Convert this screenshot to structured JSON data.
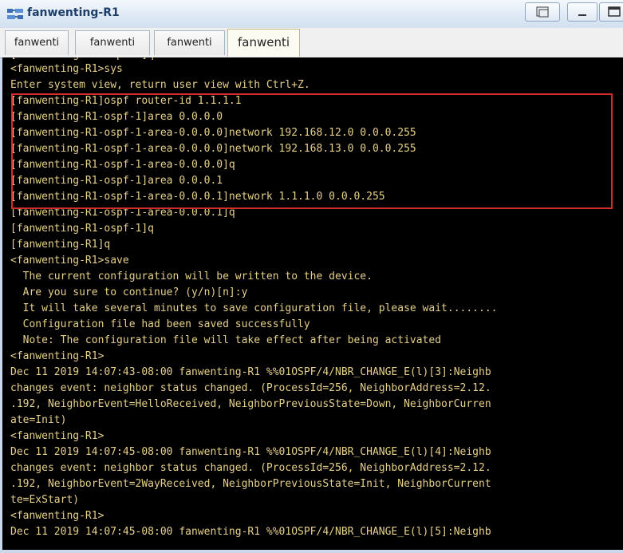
{
  "window": {
    "title": "fanwenting-R1",
    "icon": "network-device-icon",
    "controls": [
      "restore-icon",
      "minimize-icon",
      "maximize-icon"
    ]
  },
  "tabs": [
    {
      "label": "fanwenti",
      "active": false
    },
    {
      "label": "fanwenti",
      "active": false
    },
    {
      "label": "fanwenti",
      "active": false
    },
    {
      "label": "fanwenti",
      "active": true
    }
  ],
  "terminal": {
    "text_color": "#e6d08a",
    "background": "#000000",
    "highlight_color": "#d42b2b",
    "lines": [
      "<fanwenting-R1>sys",
      "Enter system view, return user view with Ctrl+Z.",
      "[fanwenting-R1]ospf router-id 1.1.1.1",
      "[fanwenting-R1-ospf-1]area 0.0.0.0",
      "[fanwenting-R1-ospf-1-area-0.0.0.0]network 192.168.12.0 0.0.0.255",
      "[fanwenting-R1-ospf-1-area-0.0.0.0]network 192.168.13.0 0.0.0.255",
      "[fanwenting-R1-ospf-1-area-0.0.0.0]q",
      "[fanwenting-R1-ospf-1]area 0.0.0.1",
      "[fanwenting-R1-ospf-1-area-0.0.0.1]network 1.1.1.0 0.0.0.255",
      "[fanwenting-R1-ospf-1-area-0.0.0.1]q",
      "[fanwenting-R1-ospf-1]q",
      "[fanwenting-R1]q",
      "<fanwenting-R1>save",
      "  The current configuration will be written to the device.",
      "  Are you sure to continue? (y/n)[n]:y",
      "  It will take several minutes to save configuration file, please wait........",
      "  Configuration file had been saved successfully",
      "  Note: The configuration file will take effect after being activated",
      "<fanwenting-R1>",
      "Dec 11 2019 14:07:43-08:00 fanwenting-R1 %%01OSPF/4/NBR_CHANGE_E(l)[3]:Neighb",
      "changes event: neighbor status changed. (ProcessId=256, NeighborAddress=2.12.",
      ".192, NeighborEvent=HelloReceived, NeighborPreviousState=Down, NeighborCurren",
      "ate=Init)",
      "<fanwenting-R1>",
      "Dec 11 2019 14:07:45-08:00 fanwenting-R1 %%01OSPF/4/NBR_CHANGE_E(l)[4]:Neighb",
      "changes event: neighbor status changed. (ProcessId=256, NeighborAddress=2.12.",
      ".192, NeighborEvent=2WayReceived, NeighborPreviousState=Init, NeighborCurrent",
      "te=ExStart)",
      "<fanwenting-R1>",
      "Dec 11 2019 14:07:45-08:00 fanwenting-R1 %%01OSPF/4/NBR_CHANGE_E(l)[5]:Neighb"
    ]
  }
}
